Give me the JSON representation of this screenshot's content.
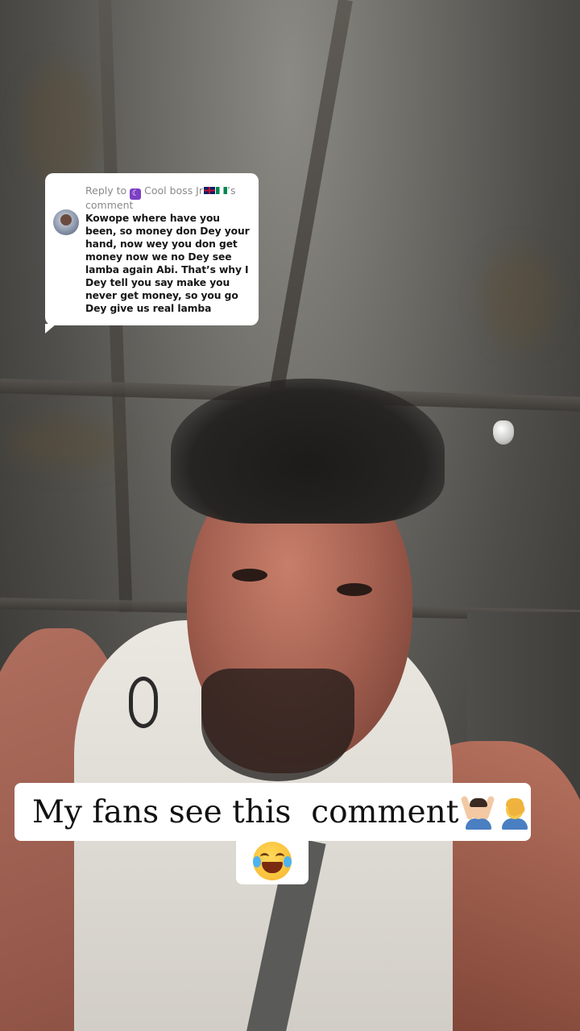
{
  "reply_comment": {
    "prefix": "Reply to",
    "badge_icon": "moon-icon",
    "username": "Cool boss Jr",
    "flags": [
      "uk-flag-icon",
      "nigeria-flag-icon"
    ],
    "suffix": "’s comment",
    "text": "Kowope where have you been, so money don Dey your hand, now wey you don get money now we no Dey see lamba again Abi. That’s why I Dey tell you say make you never get money, so you go Dey give us real lamba"
  },
  "caption": {
    "text": "My fans see this  comment",
    "emojis": [
      "person-gesturing-ok-emoji",
      "person-facepalming-emoji",
      "face-with-tears-of-joy-emoji"
    ]
  },
  "colors": {
    "bubble_bg": "#ffffff",
    "bubble_header": "#8a8a8a",
    "bubble_text": "#161616",
    "caption_text": "#111111",
    "badge": "#7d3fc4"
  }
}
